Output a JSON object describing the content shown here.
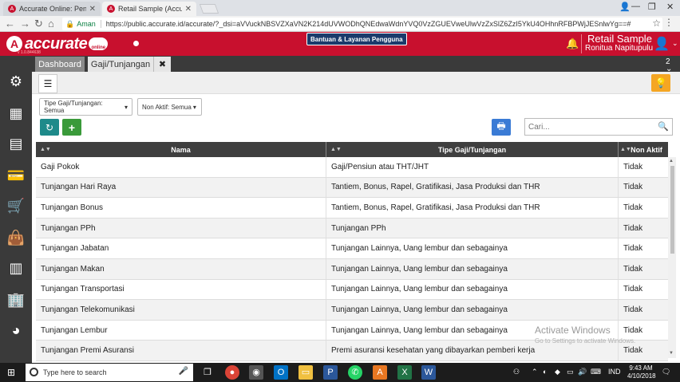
{
  "browser": {
    "tabs": [
      {
        "title": "Accurate Online: Pengat"
      },
      {
        "title": "Retail Sample (Accurate"
      }
    ],
    "secure_label": "Aman",
    "url": "https://public.accurate.id/accurate/?_dsi=aVVuckNBSVZXaVN2K214dUVWODhQNEdwaWdnYVQ0VzZGUEVweUlwVzZxSlZ6ZzI5YkU4OHhnRFBPWjJESnlwYg==#"
  },
  "app": {
    "brand": "accurate",
    "brand_sub": "online",
    "version": "v 1.0.844638",
    "help_button": "Bantuan & Layanan Pengguna",
    "company": "Retail Sample",
    "user": "Ronitua Napitupulu",
    "brand_color": "#c8102e"
  },
  "tabs": {
    "dashboard": "Dashboard",
    "current": "Gaji/Tunjangan",
    "close": "✖",
    "count": "2"
  },
  "filters": {
    "type": "Tipe Gaji/Tunjangan: Semua",
    "inactive": "Non Aktif: Semua"
  },
  "search": {
    "placeholder": "Cari..."
  },
  "table": {
    "headers": [
      "Nama",
      "Tipe Gaji/Tunjangan",
      "Non Aktif"
    ],
    "rows": [
      [
        "Gaji Pokok",
        "Gaji/Pensiun atau THT/JHT",
        "Tidak"
      ],
      [
        "Tunjangan Hari Raya",
        "Tantiem, Bonus, Rapel, Gratifikasi, Jasa Produksi dan THR",
        "Tidak"
      ],
      [
        "Tunjangan Bonus",
        "Tantiem, Bonus, Rapel, Gratifikasi, Jasa Produksi dan THR",
        "Tidak"
      ],
      [
        "Tunjangan PPh",
        "Tunjangan PPh",
        "Tidak"
      ],
      [
        "Tunjangan Jabatan",
        "Tunjangan Lainnya, Uang lembur dan sebagainya",
        "Tidak"
      ],
      [
        "Tunjangan Makan",
        "Tunjangan Lainnya, Uang lembur dan sebagainya",
        "Tidak"
      ],
      [
        "Tunjangan Transportasi",
        "Tunjangan Lainnya, Uang lembur dan sebagainya",
        "Tidak"
      ],
      [
        "Tunjangan Telekomunikasi",
        "Tunjangan Lainnya, Uang lembur dan sebagainya",
        "Tidak"
      ],
      [
        "Tunjangan Lembur",
        "Tunjangan Lainnya, Uang lembur dan sebagainya",
        "Tidak"
      ],
      [
        "Tunjangan Premi Asuransi",
        "Premi asuransi kesehatan yang dibayarkan pemberi kerja",
        "Tidak"
      ]
    ]
  },
  "watermark": {
    "line1": "Activate Windows",
    "line2": "Go to Settings to activate Windows."
  },
  "taskbar": {
    "search_placeholder": "Type here to search",
    "lang": "IND",
    "time": "9:43 AM",
    "date": "4/10/2018"
  }
}
